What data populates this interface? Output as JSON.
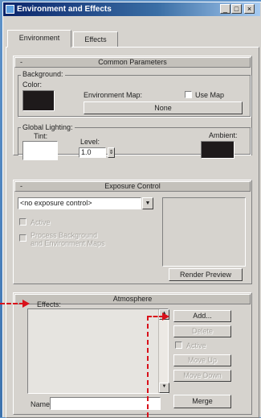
{
  "window": {
    "title": "Environment and Effects",
    "controls": [
      "_",
      "□",
      "×"
    ]
  },
  "tabs": [
    "Environment",
    "Effects"
  ],
  "common": {
    "header": "Common Parameters",
    "collapse": "-",
    "background_label": "Background:",
    "color_label": "Color:",
    "background_color": "#1e1a1b",
    "env_map_label": "Environment Map:",
    "use_map_label": "Use Map",
    "map_button": "None",
    "global_lighting_label": "Global Lighting:",
    "tint_label": "Tint:",
    "tint_color": "#ffffff",
    "level_label": "Level:",
    "level_value": "1.0",
    "ambient_label": "Ambient:",
    "ambient_color": "#1e1a1b"
  },
  "exposure": {
    "header": "Exposure Control",
    "collapse": "-",
    "dropdown_value": "<no exposure control>",
    "active_label": "Active",
    "process_label_1": "Process Background",
    "process_label_2": "and Environment Maps",
    "render_preview": "Render Preview"
  },
  "atmosphere": {
    "header": "Atmosphere",
    "collapse": "-",
    "effects_label": "Effects:",
    "buttons": {
      "add": "Add...",
      "delete": "Delete",
      "active": "Active",
      "move_up": "Move Up",
      "move_down": "Move Down",
      "merge": "Merge"
    },
    "name_label": "Name:",
    "name_value": ""
  },
  "colors": {
    "annotation_red": "#d9101a"
  }
}
